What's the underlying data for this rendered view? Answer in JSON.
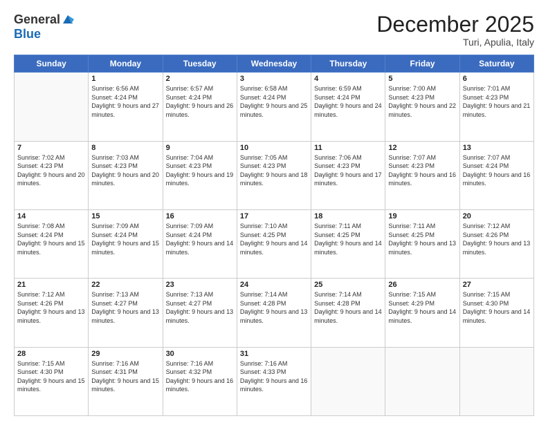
{
  "logo": {
    "general": "General",
    "blue": "Blue"
  },
  "title": "December 2025",
  "subtitle": "Turi, Apulia, Italy",
  "days": [
    "Sunday",
    "Monday",
    "Tuesday",
    "Wednesday",
    "Thursday",
    "Friday",
    "Saturday"
  ],
  "weeks": [
    [
      {
        "day": "",
        "sunrise": "",
        "sunset": "",
        "daylight": ""
      },
      {
        "day": "1",
        "sunrise": "Sunrise: 6:56 AM",
        "sunset": "Sunset: 4:24 PM",
        "daylight": "Daylight: 9 hours and 27 minutes."
      },
      {
        "day": "2",
        "sunrise": "Sunrise: 6:57 AM",
        "sunset": "Sunset: 4:24 PM",
        "daylight": "Daylight: 9 hours and 26 minutes."
      },
      {
        "day": "3",
        "sunrise": "Sunrise: 6:58 AM",
        "sunset": "Sunset: 4:24 PM",
        "daylight": "Daylight: 9 hours and 25 minutes."
      },
      {
        "day": "4",
        "sunrise": "Sunrise: 6:59 AM",
        "sunset": "Sunset: 4:24 PM",
        "daylight": "Daylight: 9 hours and 24 minutes."
      },
      {
        "day": "5",
        "sunrise": "Sunrise: 7:00 AM",
        "sunset": "Sunset: 4:23 PM",
        "daylight": "Daylight: 9 hours and 22 minutes."
      },
      {
        "day": "6",
        "sunrise": "Sunrise: 7:01 AM",
        "sunset": "Sunset: 4:23 PM",
        "daylight": "Daylight: 9 hours and 21 minutes."
      }
    ],
    [
      {
        "day": "7",
        "sunrise": "Sunrise: 7:02 AM",
        "sunset": "Sunset: 4:23 PM",
        "daylight": "Daylight: 9 hours and 20 minutes."
      },
      {
        "day": "8",
        "sunrise": "Sunrise: 7:03 AM",
        "sunset": "Sunset: 4:23 PM",
        "daylight": "Daylight: 9 hours and 20 minutes."
      },
      {
        "day": "9",
        "sunrise": "Sunrise: 7:04 AM",
        "sunset": "Sunset: 4:23 PM",
        "daylight": "Daylight: 9 hours and 19 minutes."
      },
      {
        "day": "10",
        "sunrise": "Sunrise: 7:05 AM",
        "sunset": "Sunset: 4:23 PM",
        "daylight": "Daylight: 9 hours and 18 minutes."
      },
      {
        "day": "11",
        "sunrise": "Sunrise: 7:06 AM",
        "sunset": "Sunset: 4:23 PM",
        "daylight": "Daylight: 9 hours and 17 minutes."
      },
      {
        "day": "12",
        "sunrise": "Sunrise: 7:07 AM",
        "sunset": "Sunset: 4:23 PM",
        "daylight": "Daylight: 9 hours and 16 minutes."
      },
      {
        "day": "13",
        "sunrise": "Sunrise: 7:07 AM",
        "sunset": "Sunset: 4:24 PM",
        "daylight": "Daylight: 9 hours and 16 minutes."
      }
    ],
    [
      {
        "day": "14",
        "sunrise": "Sunrise: 7:08 AM",
        "sunset": "Sunset: 4:24 PM",
        "daylight": "Daylight: 9 hours and 15 minutes."
      },
      {
        "day": "15",
        "sunrise": "Sunrise: 7:09 AM",
        "sunset": "Sunset: 4:24 PM",
        "daylight": "Daylight: 9 hours and 15 minutes."
      },
      {
        "day": "16",
        "sunrise": "Sunrise: 7:09 AM",
        "sunset": "Sunset: 4:24 PM",
        "daylight": "Daylight: 9 hours and 14 minutes."
      },
      {
        "day": "17",
        "sunrise": "Sunrise: 7:10 AM",
        "sunset": "Sunset: 4:25 PM",
        "daylight": "Daylight: 9 hours and 14 minutes."
      },
      {
        "day": "18",
        "sunrise": "Sunrise: 7:11 AM",
        "sunset": "Sunset: 4:25 PM",
        "daylight": "Daylight: 9 hours and 14 minutes."
      },
      {
        "day": "19",
        "sunrise": "Sunrise: 7:11 AM",
        "sunset": "Sunset: 4:25 PM",
        "daylight": "Daylight: 9 hours and 13 minutes."
      },
      {
        "day": "20",
        "sunrise": "Sunrise: 7:12 AM",
        "sunset": "Sunset: 4:26 PM",
        "daylight": "Daylight: 9 hours and 13 minutes."
      }
    ],
    [
      {
        "day": "21",
        "sunrise": "Sunrise: 7:12 AM",
        "sunset": "Sunset: 4:26 PM",
        "daylight": "Daylight: 9 hours and 13 minutes."
      },
      {
        "day": "22",
        "sunrise": "Sunrise: 7:13 AM",
        "sunset": "Sunset: 4:27 PM",
        "daylight": "Daylight: 9 hours and 13 minutes."
      },
      {
        "day": "23",
        "sunrise": "Sunrise: 7:13 AM",
        "sunset": "Sunset: 4:27 PM",
        "daylight": "Daylight: 9 hours and 13 minutes."
      },
      {
        "day": "24",
        "sunrise": "Sunrise: 7:14 AM",
        "sunset": "Sunset: 4:28 PM",
        "daylight": "Daylight: 9 hours and 13 minutes."
      },
      {
        "day": "25",
        "sunrise": "Sunrise: 7:14 AM",
        "sunset": "Sunset: 4:28 PM",
        "daylight": "Daylight: 9 hours and 14 minutes."
      },
      {
        "day": "26",
        "sunrise": "Sunrise: 7:15 AM",
        "sunset": "Sunset: 4:29 PM",
        "daylight": "Daylight: 9 hours and 14 minutes."
      },
      {
        "day": "27",
        "sunrise": "Sunrise: 7:15 AM",
        "sunset": "Sunset: 4:30 PM",
        "daylight": "Daylight: 9 hours and 14 minutes."
      }
    ],
    [
      {
        "day": "28",
        "sunrise": "Sunrise: 7:15 AM",
        "sunset": "Sunset: 4:30 PM",
        "daylight": "Daylight: 9 hours and 15 minutes."
      },
      {
        "day": "29",
        "sunrise": "Sunrise: 7:16 AM",
        "sunset": "Sunset: 4:31 PM",
        "daylight": "Daylight: 9 hours and 15 minutes."
      },
      {
        "day": "30",
        "sunrise": "Sunrise: 7:16 AM",
        "sunset": "Sunset: 4:32 PM",
        "daylight": "Daylight: 9 hours and 16 minutes."
      },
      {
        "day": "31",
        "sunrise": "Sunrise: 7:16 AM",
        "sunset": "Sunset: 4:33 PM",
        "daylight": "Daylight: 9 hours and 16 minutes."
      },
      {
        "day": "",
        "sunrise": "",
        "sunset": "",
        "daylight": ""
      },
      {
        "day": "",
        "sunrise": "",
        "sunset": "",
        "daylight": ""
      },
      {
        "day": "",
        "sunrise": "",
        "sunset": "",
        "daylight": ""
      }
    ]
  ]
}
